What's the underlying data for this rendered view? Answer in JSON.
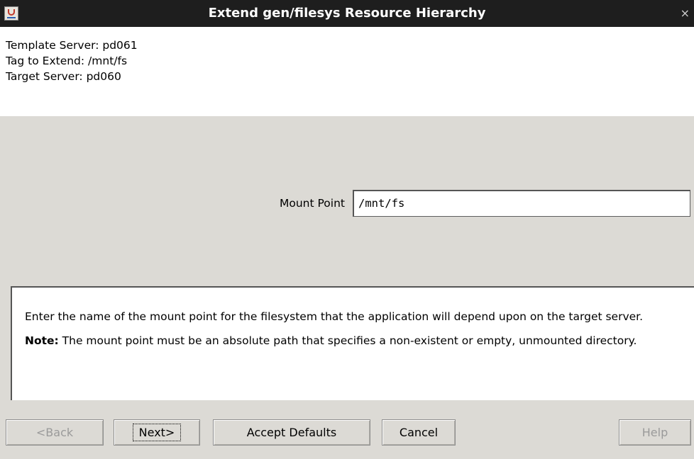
{
  "window": {
    "title": "Extend gen/filesys Resource Hierarchy",
    "close_glyph": "×",
    "app_icon": "java-cup-icon"
  },
  "info": {
    "template_server": "Template Server: pd061",
    "tag_to_extend": "Tag to Extend: /mnt/fs",
    "target_server": "Target Server: pd060"
  },
  "form": {
    "mount_point_label": "Mount Point",
    "mount_point_value": "/mnt/fs"
  },
  "help": {
    "description": "Enter the name of the mount point for the filesystem that the application will depend upon on the target server.",
    "note_label": "Note:",
    "note_text": " The mount point must be an absolute path that specifies a non-existent or empty, unmounted directory."
  },
  "buttons": {
    "back": "<Back",
    "next": "Next>",
    "accept_defaults": "Accept Defaults",
    "cancel": "Cancel",
    "help": "Help"
  },
  "colors": {
    "titlebar": "#1e1e1e",
    "panel": "#dcdad5",
    "disabled_text": "#9a9a9a"
  }
}
